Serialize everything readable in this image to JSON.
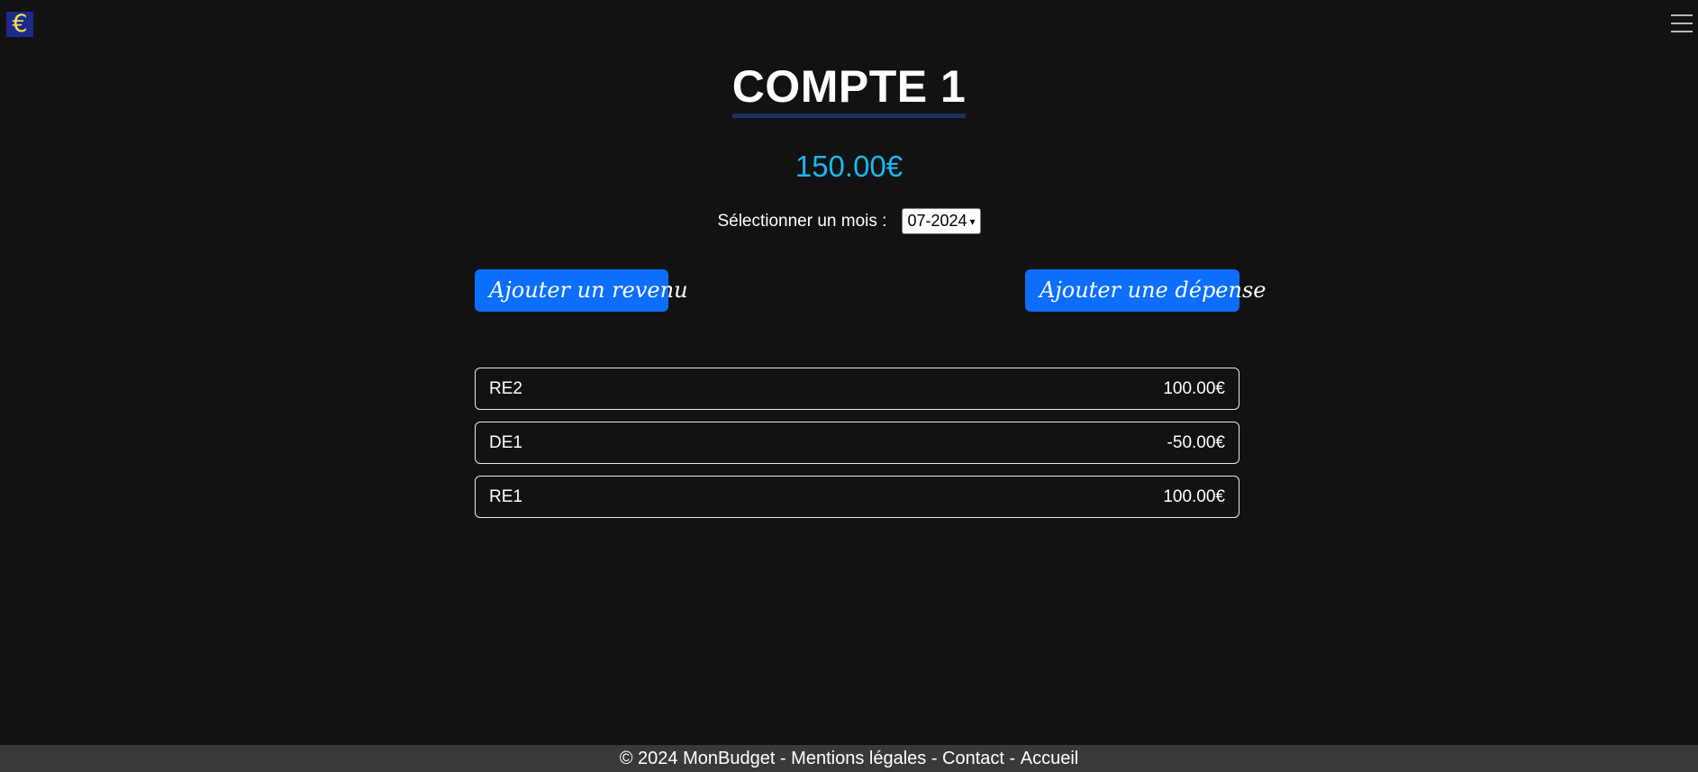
{
  "header": {
    "logo_glyph": "€",
    "menu_icon": "hamburger-menu-icon"
  },
  "account": {
    "title": "COMPTE 1",
    "balance": "150.00€"
  },
  "month_selector": {
    "label": "Sélectionner un mois :",
    "selected": "07-2024"
  },
  "actions": {
    "add_income": "Ajouter un revenu",
    "add_expense": "Ajouter une dépense"
  },
  "transactions": [
    {
      "name": "RE2",
      "amount": "100.00€"
    },
    {
      "name": "DE1",
      "amount": "-50.00€"
    },
    {
      "name": "RE1",
      "amount": "100.00€"
    }
  ],
  "footer": {
    "copyright": "© 2024 MonBudget",
    "separator": " - ",
    "links": [
      "Mentions légales",
      "Contact",
      "Accueil"
    ]
  },
  "colors": {
    "background": "#121212",
    "balance": "#18b7f0",
    "button": "#0d6efd",
    "footer_bg": "#393939",
    "logo_bg": "#1c2b8a",
    "logo_fg": "#f2e14a"
  }
}
